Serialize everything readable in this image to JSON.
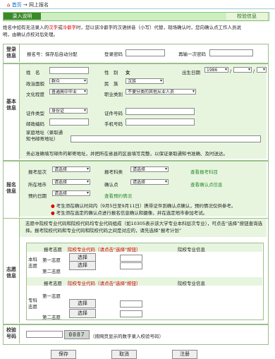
{
  "breadcrumb": {
    "home": "首页",
    "sep": "→",
    "current": "网上报名",
    "icon": "home-icon"
  },
  "tabs": {
    "left": "录入说明",
    "right": "校验信息"
  },
  "notice": {
    "line1_a": "姓名中如有无法录入的",
    "line1_b": "汉字",
    "line1_c": "或",
    "line1_d": "冷僻字",
    "line1_e": "时，您以该冷僻字的汉语拼音（小写）代替，现场确认时，您向确认点工作人员说",
    "line2": "明，由确认点校对后处理。"
  },
  "login": {
    "section": "登录信息",
    "regno_label": "报名号：",
    "regno_value": "保存后自动分配",
    "password_label": "登录密码",
    "password_value": "",
    "password2_label": "再输一次密码",
    "password2_value": ""
  },
  "basic": {
    "section": "基本信息",
    "name_label": "姓　名",
    "name_value": "",
    "gender_label": "性　别",
    "gender_value": "女",
    "birth_label": "出生日期",
    "birth_year": "1986",
    "birth_month": "",
    "political_label": "政治面貌",
    "political_value": "群众",
    "nation_label": "民　族",
    "nation_value": "汉族",
    "edu_label": "文化程度",
    "edu_value": "普通高中毕业",
    "job_label": "职业类别",
    "job_value": "不便分类的其他从业人员",
    "idtype_label": "证件类型",
    "idtype_value": "身份证",
    "idno_label": "证件号码",
    "idno_value": "",
    "zip_label": "邮政编码",
    "zip_value": "",
    "mobile_label": "手机号码",
    "mobile_value": "",
    "addr_label": "家庭地址（录取通知书邮寄地址）",
    "addr_value": "",
    "addr_note": "务必准确填写邮件的邮寄地址，并把所在省县的区县填写完整，以保证录取通知书准确、及时送达。"
  },
  "exam": {
    "section": "报名信息",
    "level_label": "报考层次",
    "level_value": "请选择",
    "subject_label": "报考科类",
    "subject_value": "请选择",
    "subject_link": "查看报考科目",
    "city_label": "所在地市",
    "city_value": "请选择",
    "site_label": "确认点",
    "site_value": "请选择",
    "site_link": "查看确认点信息",
    "date_label": "预约日期",
    "date_value": "请选择",
    "date_link": "查看预约情况",
    "note1": "考生须在确认时间内（9月5日至9月11日）携带证件到确认点确认，预约情况仅供参考。",
    "note2": "考生须在选定的确认点进行报名信息确认和摄像，并在选定地市参加考试。"
  },
  "school": {
    "section": "志愿信息",
    "intro": "志愿中院校专业代码和院校代码均专业代码组成（如10305表示该大学专业本科层次专业），可点击“选择”按钮查询选择。报考院校代码和专业代码和院校代码之间是对应的，请先选择“报考计划”",
    "intro_link": "报考计划",
    "col_choice": "报考志愿",
    "col_code": "院校专业代码（请点击\"选择\"按钮）",
    "col_info": "院校专业信息",
    "bk_label": "本科志愿",
    "zk_label": "专科志愿",
    "first": "第一志愿",
    "second": "第二志愿",
    "select_btn": "选择",
    "code_values": [
      "",
      "",
      "",
      ""
    ]
  },
  "verify": {
    "section": "校验号码",
    "input_value": "",
    "code": "0087",
    "hint": "（按网页显示的数字录入校验号码）"
  },
  "actions": {
    "save": "保存",
    "cancel": "取消",
    "register": "注册"
  }
}
